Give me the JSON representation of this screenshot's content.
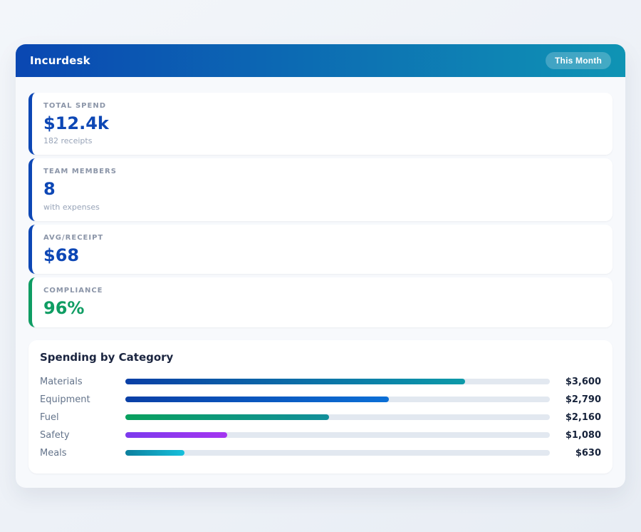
{
  "header": {
    "title": "Incurdesk",
    "badge": "This Month",
    "gradient_from": "#0a47b2",
    "gradient_to": "#0f94b4"
  },
  "stats": [
    {
      "label": "TOTAL SPEND",
      "value": "$12.4k",
      "sub": "182 receipts",
      "accent": "#0d47b5",
      "value_color": "#0d47b5"
    },
    {
      "label": "TEAM MEMBERS",
      "value": "8",
      "sub": "with expenses",
      "accent": "#0d47b5",
      "value_color": "#0d47b5"
    },
    {
      "label": "AVG/RECEIPT",
      "value": "$68",
      "sub": "",
      "accent": "#0d47b5",
      "value_color": "#0d47b5"
    },
    {
      "label": "COMPLIANCE",
      "value": "96%",
      "sub": "",
      "accent": "#0f9d63",
      "value_color": "#0f9d63"
    }
  ],
  "chart_data": {
    "type": "bar",
    "orientation": "horizontal",
    "title": "Spending by Category",
    "categories": [
      "Materials",
      "Equipment",
      "Fuel",
      "Safety",
      "Meals"
    ],
    "values": [
      3600,
      2790,
      2160,
      1080,
      630
    ],
    "value_labels": [
      "$3,600",
      "$2,790",
      "$2,160",
      "$1,080",
      "$630"
    ],
    "axis_max": 4500,
    "track_color": "#e2e8f0",
    "bar_gradients": [
      {
        "from": "#0a3fa6",
        "to": "#0d9aa8"
      },
      {
        "from": "#0a3fa6",
        "to": "#0b6fd6"
      },
      {
        "from": "#09a05e",
        "to": "#128f9b"
      },
      {
        "from": "#7c3aed",
        "to": "#a435f0"
      },
      {
        "from": "#0c7f9d",
        "to": "#16c0dc"
      }
    ]
  }
}
